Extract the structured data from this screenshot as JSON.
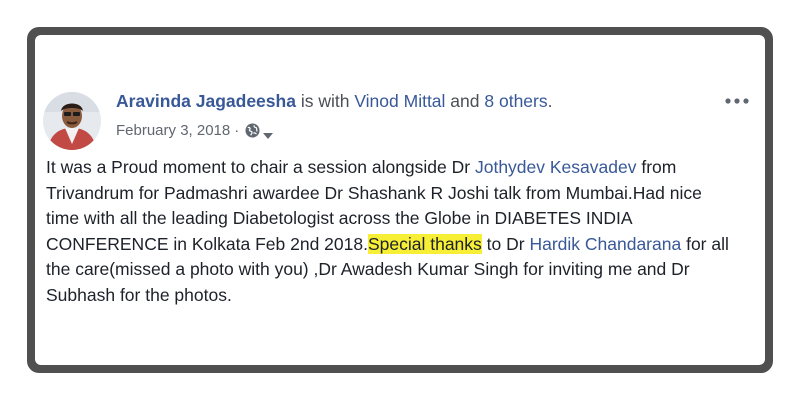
{
  "post": {
    "author": "Aravinda Jagadeesha",
    "with_text": " is with ",
    "tagged_person": "Vinod Mittal",
    "and_text": " and ",
    "others": "8 others",
    "period": ".",
    "date": "February 3, 2018",
    "meta_separator": "·",
    "privacy_icon": "globe-icon",
    "more_icon": "more-options-icon",
    "body": {
      "seg1": "It was a Proud moment to chair a session alongside Dr ",
      "mention1": "Jothydev Kesavadev",
      "seg2": " from Trivandrum for Padmashri awardee Dr Shashank R Joshi talk from Mumbai.Had nice time with all the leading Diabetologist across the Globe in DIABETES INDIA CONFERENCE in Kolkata Feb 2nd 2018.",
      "highlight": "Special thanks",
      "seg3": " to Dr ",
      "mention2": "Hardik Chandarana",
      "seg4": " for all the care(missed a photo with you) ,Dr Awadesh Kumar Singh for inviting me and Dr Subhash for the photos."
    }
  },
  "colors": {
    "frame": "#505050",
    "link": "#385898",
    "text": "#1d2129",
    "meta": "#616770",
    "highlight": "#f6ef36"
  }
}
